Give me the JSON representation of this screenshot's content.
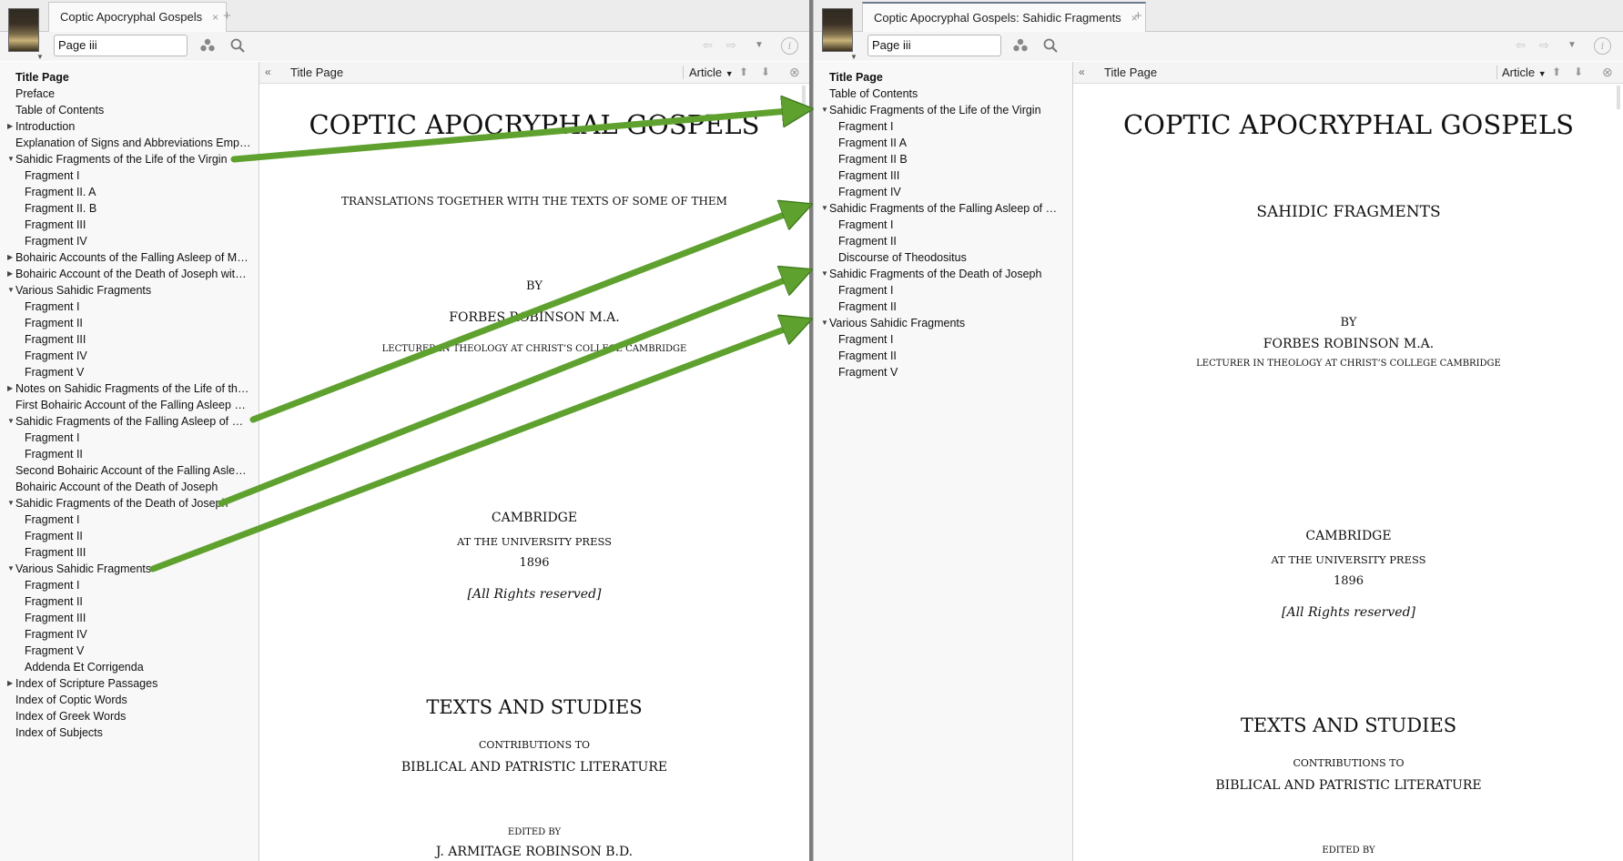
{
  "left": {
    "tab_title": "Coptic Apocryphal Gospels",
    "tab_close": "×",
    "new_tab": "+",
    "search_value": "Page iii",
    "toc": [
      {
        "label": "Title Page",
        "level": 0,
        "tri": "",
        "bold": true
      },
      {
        "label": "Preface",
        "level": 0,
        "tri": ""
      },
      {
        "label": "Table of Contents",
        "level": 0,
        "tri": ""
      },
      {
        "label": "Introduction",
        "level": 0,
        "tri": "▶"
      },
      {
        "label": "Explanation of Signs and Abbreviations Emplo…",
        "level": 0,
        "tri": ""
      },
      {
        "label": "Sahidic Fragments of the Life of the Virgin",
        "level": 0,
        "tri": "▼"
      },
      {
        "label": "Fragment I",
        "level": 1,
        "tri": ""
      },
      {
        "label": "Fragment II. A",
        "level": 1,
        "tri": ""
      },
      {
        "label": "Fragment II. B",
        "level": 1,
        "tri": ""
      },
      {
        "label": "Fragment III",
        "level": 1,
        "tri": ""
      },
      {
        "label": "Fragment IV",
        "level": 1,
        "tri": ""
      },
      {
        "label": "Bohairic Accounts of the Falling Asleep of Mary…",
        "level": 0,
        "tri": "▶"
      },
      {
        "label": "Bohairic Account of the Death of Joseph with…",
        "level": 0,
        "tri": "▶"
      },
      {
        "label": "Various Sahidic Fragments",
        "level": 0,
        "tri": "▼"
      },
      {
        "label": "Fragment I",
        "level": 1,
        "tri": ""
      },
      {
        "label": "Fragment II",
        "level": 1,
        "tri": ""
      },
      {
        "label": "Fragment III",
        "level": 1,
        "tri": ""
      },
      {
        "label": "Fragment IV",
        "level": 1,
        "tri": ""
      },
      {
        "label": "Fragment V",
        "level": 1,
        "tri": ""
      },
      {
        "label": "Notes on Sahidic Fragments of the Life of the V…",
        "level": 0,
        "tri": "▶"
      },
      {
        "label": "First Bohairic Account of the Falling Asleep of…",
        "level": 0,
        "tri": ""
      },
      {
        "label": "Sahidic Fragments of the Falling Asleep of Mary",
        "level": 0,
        "tri": "▼"
      },
      {
        "label": "Fragment I",
        "level": 1,
        "tri": ""
      },
      {
        "label": "Fragment II",
        "level": 1,
        "tri": ""
      },
      {
        "label": "Second Bohairic Account of the Falling Asleep…",
        "level": 0,
        "tri": ""
      },
      {
        "label": "Bohairic Account of the Death of Joseph",
        "level": 0,
        "tri": ""
      },
      {
        "label": "Sahidic Fragments of the Death of Joseph",
        "level": 0,
        "tri": "▼"
      },
      {
        "label": "Fragment I",
        "level": 1,
        "tri": ""
      },
      {
        "label": "Fragment II",
        "level": 1,
        "tri": ""
      },
      {
        "label": "Fragment III",
        "level": 1,
        "tri": ""
      },
      {
        "label": "Various Sahidic Fragments",
        "level": 0,
        "tri": "▼"
      },
      {
        "label": "Fragment I",
        "level": 1,
        "tri": ""
      },
      {
        "label": "Fragment II",
        "level": 1,
        "tri": ""
      },
      {
        "label": "Fragment III",
        "level": 1,
        "tri": ""
      },
      {
        "label": "Fragment IV",
        "level": 1,
        "tri": ""
      },
      {
        "label": "Fragment V",
        "level": 1,
        "tri": ""
      },
      {
        "label": "Addenda Et Corrigenda",
        "level": 1,
        "tri": ""
      },
      {
        "label": "Index of Scripture Passages",
        "level": 0,
        "tri": "▶"
      },
      {
        "label": "Index of Coptic Words",
        "level": 0,
        "tri": ""
      },
      {
        "label": "Index of Greek Words",
        "level": 0,
        "tri": ""
      },
      {
        "label": "Index of Subjects",
        "level": 0,
        "tri": ""
      }
    ],
    "reader": {
      "collapse": "«",
      "section_title": "Title Page",
      "view_mode": "Article",
      "up": "⬆",
      "down": "⬇",
      "close": "⊗"
    },
    "page": {
      "title": "COPTIC APOCRYPHAL GOSPELS",
      "subtitle": "TRANSLATIONS TOGETHER WITH THE TEXTS OF SOME OF THEM",
      "by": "BY",
      "author": "FORBES ROBINSON M.A.",
      "author_title": "LECTURER IN THEOLOGY AT CHRIST’S COLLEGE CAMBRIDGE",
      "place": "CAMBRIDGE",
      "press": "AT THE UNIVERSITY PRESS",
      "year": "1896",
      "rights": "[All Rights reserved]",
      "series": "TEXTS AND STUDIES",
      "contrib": "CONTRIBUTIONS TO",
      "lit": "BIBLICAL AND PATRISTIC LITERATURE",
      "edited_by": "EDITED BY",
      "editor": "J. ARMITAGE ROBINSON B.D."
    }
  },
  "right": {
    "tab_title": "Coptic Apocryphal Gospels: Sahidic Fragments",
    "tab_close": "×",
    "new_tab": "+",
    "search_value": "Page iii",
    "toc": [
      {
        "label": "Title Page",
        "level": 0,
        "tri": "",
        "bold": true
      },
      {
        "label": "Table of Contents",
        "level": 0,
        "tri": ""
      },
      {
        "label": "Sahidic Fragments of the Life of the Virgin",
        "level": 0,
        "tri": "▼"
      },
      {
        "label": "Fragment I",
        "level": 1,
        "tri": ""
      },
      {
        "label": "Fragment II A",
        "level": 1,
        "tri": ""
      },
      {
        "label": "Fragment II B",
        "level": 1,
        "tri": ""
      },
      {
        "label": "Fragment III",
        "level": 1,
        "tri": ""
      },
      {
        "label": "Fragment IV",
        "level": 1,
        "tri": ""
      },
      {
        "label": "Sahidic Fragments of the Falling Asleep of Mary",
        "level": 0,
        "tri": "▼"
      },
      {
        "label": "Fragment I",
        "level": 1,
        "tri": ""
      },
      {
        "label": "Fragment II",
        "level": 1,
        "tri": ""
      },
      {
        "label": "Discourse of Theodositus",
        "level": 1,
        "tri": ""
      },
      {
        "label": "Sahidic Fragments of the Death of Joseph",
        "level": 0,
        "tri": "▼"
      },
      {
        "label": "Fragment I",
        "level": 1,
        "tri": ""
      },
      {
        "label": "Fragment II",
        "level": 1,
        "tri": ""
      },
      {
        "label": "Various Sahidic Fragments",
        "level": 0,
        "tri": "▼"
      },
      {
        "label": "Fragment I",
        "level": 1,
        "tri": ""
      },
      {
        "label": "Fragment II",
        "level": 1,
        "tri": ""
      },
      {
        "label": "Fragment V",
        "level": 1,
        "tri": ""
      }
    ],
    "reader": {
      "collapse": "«",
      "section_title": "Title Page",
      "view_mode": "Article",
      "up": "⬆",
      "down": "⬇",
      "close": "⊗"
    },
    "page": {
      "title": "COPTIC APOCRYPHAL GOSPELS",
      "subtitle": "SAHIDIC FRAGMENTS",
      "by": "BY",
      "author": "FORBES ROBINSON M.A.",
      "author_title": "LECTURER IN THEOLOGY AT CHRIST’S COLLEGE CAMBRIDGE",
      "place": "CAMBRIDGE",
      "press": "AT THE UNIVERSITY PRESS",
      "year": "1896",
      "rights": "[All Rights reserved]",
      "series": "TEXTS AND STUDIES",
      "contrib": "CONTRIBUTIONS TO",
      "lit": "BIBLICAL AND PATRISTIC LITERATURE",
      "edited_by": "EDITED BY"
    }
  },
  "colors": {
    "arrow": "#5fa12f",
    "arrow_dark": "#3f7a1c"
  },
  "icons": [
    "book-cover-thumbnail",
    "people-icon",
    "search-icon",
    "back-arrow-icon",
    "forward-arrow-icon",
    "dropdown-icon",
    "info-icon",
    "up-arrow-icon",
    "down-arrow-icon",
    "close-circle-icon",
    "arrow-annotation"
  ]
}
